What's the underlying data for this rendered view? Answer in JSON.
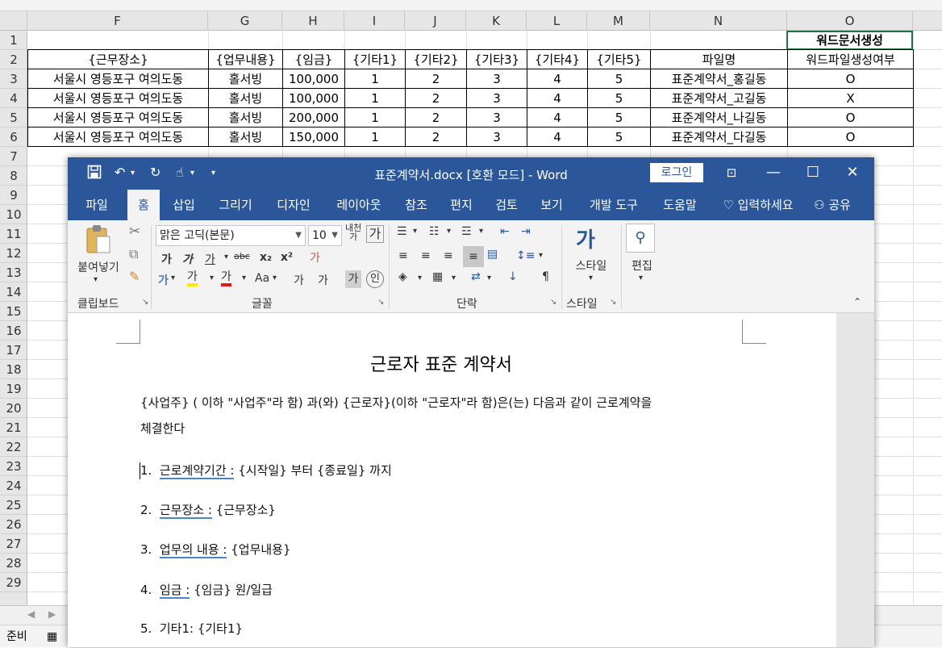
{
  "excel": {
    "columns": [
      "F",
      "G",
      "H",
      "I",
      "J",
      "K",
      "L",
      "M",
      "N",
      "O"
    ],
    "rows": [
      "1",
      "2",
      "3",
      "4",
      "5",
      "6",
      "7",
      "8",
      "9",
      "10",
      "11",
      "12",
      "13",
      "14",
      "15",
      "16",
      "17",
      "18",
      "19",
      "20",
      "21",
      "22",
      "23",
      "24",
      "25",
      "26",
      "27",
      "28",
      "29"
    ],
    "o1_label": "워드문서생성",
    "table_header": [
      "{근무장소}",
      "{업무내용}",
      "{임금}",
      "{기타1}",
      "{기타2}",
      "{기타3}",
      "{기타4}",
      "{기타5}",
      "파일명",
      "워드파일생성여부"
    ],
    "table_rows": [
      [
        "서울시 영등포구 여의도동",
        "홀서빙",
        "100,000",
        "1",
        "2",
        "3",
        "4",
        "5",
        "표준계약서_홍길동",
        "O"
      ],
      [
        "서울시 영등포구 여의도동",
        "홀서빙",
        "100,000",
        "1",
        "2",
        "3",
        "4",
        "5",
        "표준계약서_고길동",
        "X"
      ],
      [
        "서울시 영등포구 여의도동",
        "홀서빙",
        "200,000",
        "1",
        "2",
        "3",
        "4",
        "5",
        "표준계약서_나길동",
        "O"
      ],
      [
        "서울시 영등포구 여의도동",
        "홀서빙",
        "150,000",
        "1",
        "2",
        "3",
        "4",
        "5",
        "표준계약서_다길동",
        "O"
      ]
    ],
    "status": "준비"
  },
  "word": {
    "title": "표준계약서.docx [호환 모드]  -  Word",
    "login": "로그인",
    "menu": [
      "파일",
      "홈",
      "삽입",
      "그리기",
      "디자인",
      "레이아웃",
      "참조",
      "편지",
      "검토",
      "보기",
      "개발 도구",
      "도움말",
      "입력하세요",
      "공유"
    ],
    "ribbon": {
      "paste": "붙여넣기",
      "clipboard": "클립보드",
      "font_name": "맑은 고딕(본문)",
      "font_size": "10",
      "font_group": "글꼴",
      "paragraph_group": "단락",
      "style_btn": "스타일",
      "style_group": "스타일",
      "edit_btn": "편집"
    },
    "doc": {
      "heading": "근로자 표준 계약서",
      "intro1": "{사업주} ( 이하 \"사업주\"라 함) 과(와) {근로자}(이하 \"근로자\"라 함)은(는) 다음과 같이 근로계약을",
      "intro2": "체결한다",
      "item1_label": "근로계약기간 :",
      "item1_value": "{시작일} 부터 {종료일} 까지",
      "item2_label": "근무장소 :",
      "item2_value": "{근무장소}",
      "item3_label": "업무의 내용 :",
      "item3_value": "{업무내용}",
      "item4_label": "임금 :",
      "item4_value": "{임금} 원/일급",
      "item5_text": "기타1: {기타1}"
    }
  }
}
